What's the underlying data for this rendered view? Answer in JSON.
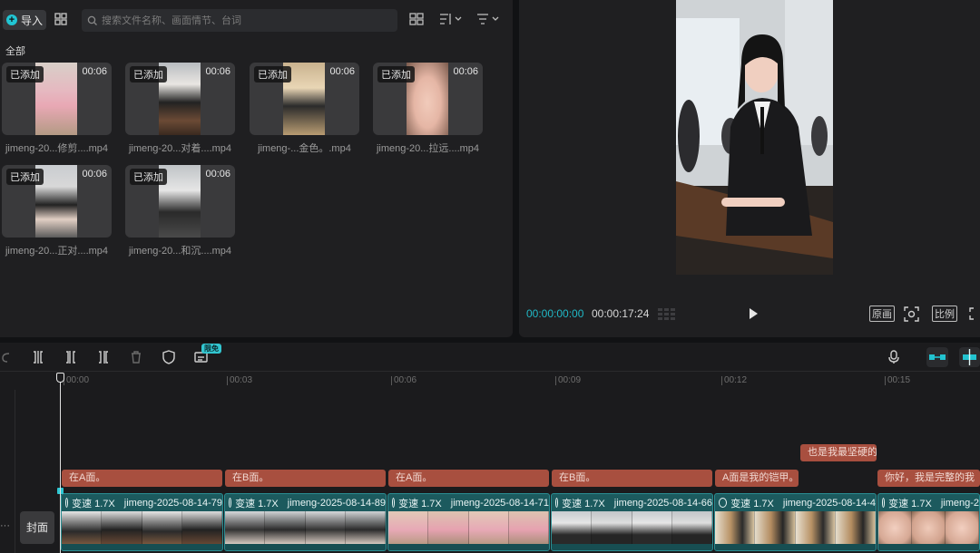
{
  "media": {
    "import_label": "导入",
    "search_placeholder": "搜索文件名称、画面情节、台词",
    "section_label": "全部",
    "items": [
      {
        "badge": "已添加",
        "duration": "00:06",
        "name": "jimeng-20...修剪....mp4"
      },
      {
        "badge": "已添加",
        "duration": "00:06",
        "name": "jimeng-20...对着....mp4"
      },
      {
        "badge": "已添加",
        "duration": "00:06",
        "name": "jimeng-...金色。.mp4"
      },
      {
        "badge": "已添加",
        "duration": "00:06",
        "name": "jimeng-20...拉远....mp4"
      },
      {
        "badge": "已添加",
        "duration": "00:06",
        "name": "jimeng-20...正对....mp4"
      },
      {
        "badge": "已添加",
        "duration": "00:06",
        "name": "jimeng-20...和沉....mp4"
      }
    ]
  },
  "player": {
    "current_time": "00:00:00:00",
    "total_time": "00:00:17:24",
    "original_label": "原画",
    "ratio_label": "比例"
  },
  "timeline": {
    "free_tag": "限免",
    "ruler_ticks": [
      "00:00",
      "00:03",
      "00:06",
      "00:09",
      "00:12",
      "00:15"
    ],
    "subtitles_top": [
      {
        "text": "也是我最坚硬的骨"
      }
    ],
    "subtitles": [
      {
        "text": "在A面。"
      },
      {
        "text": "在B面。"
      },
      {
        "text": "在A面。"
      },
      {
        "text": "在B面。"
      },
      {
        "text": "A面是我的铠甲。"
      },
      {
        "text": "你好，我是完整的我"
      }
    ],
    "cover_label": "封面",
    "dots": "···",
    "clips": [
      {
        "speed": "变速 1.7X",
        "name": "jimeng-2025-08-14-79"
      },
      {
        "speed": "变速 1.7X",
        "name": "jimeng-2025-08-14-89"
      },
      {
        "speed": "变速 1.7X",
        "name": "jimeng-2025-08-14-71"
      },
      {
        "speed": "变速 1.7X",
        "name": "jimeng-2025-08-14-66"
      },
      {
        "speed": "变速 1.7X",
        "name": "jimeng-2025-08-14-4"
      },
      {
        "speed": "变速 1.7X",
        "name": "jimeng-2"
      }
    ]
  },
  "colors": {
    "accent": "#21c6d4",
    "subtitle_bg": "#a84f3f",
    "clip_bg": "#1c5a5e"
  }
}
